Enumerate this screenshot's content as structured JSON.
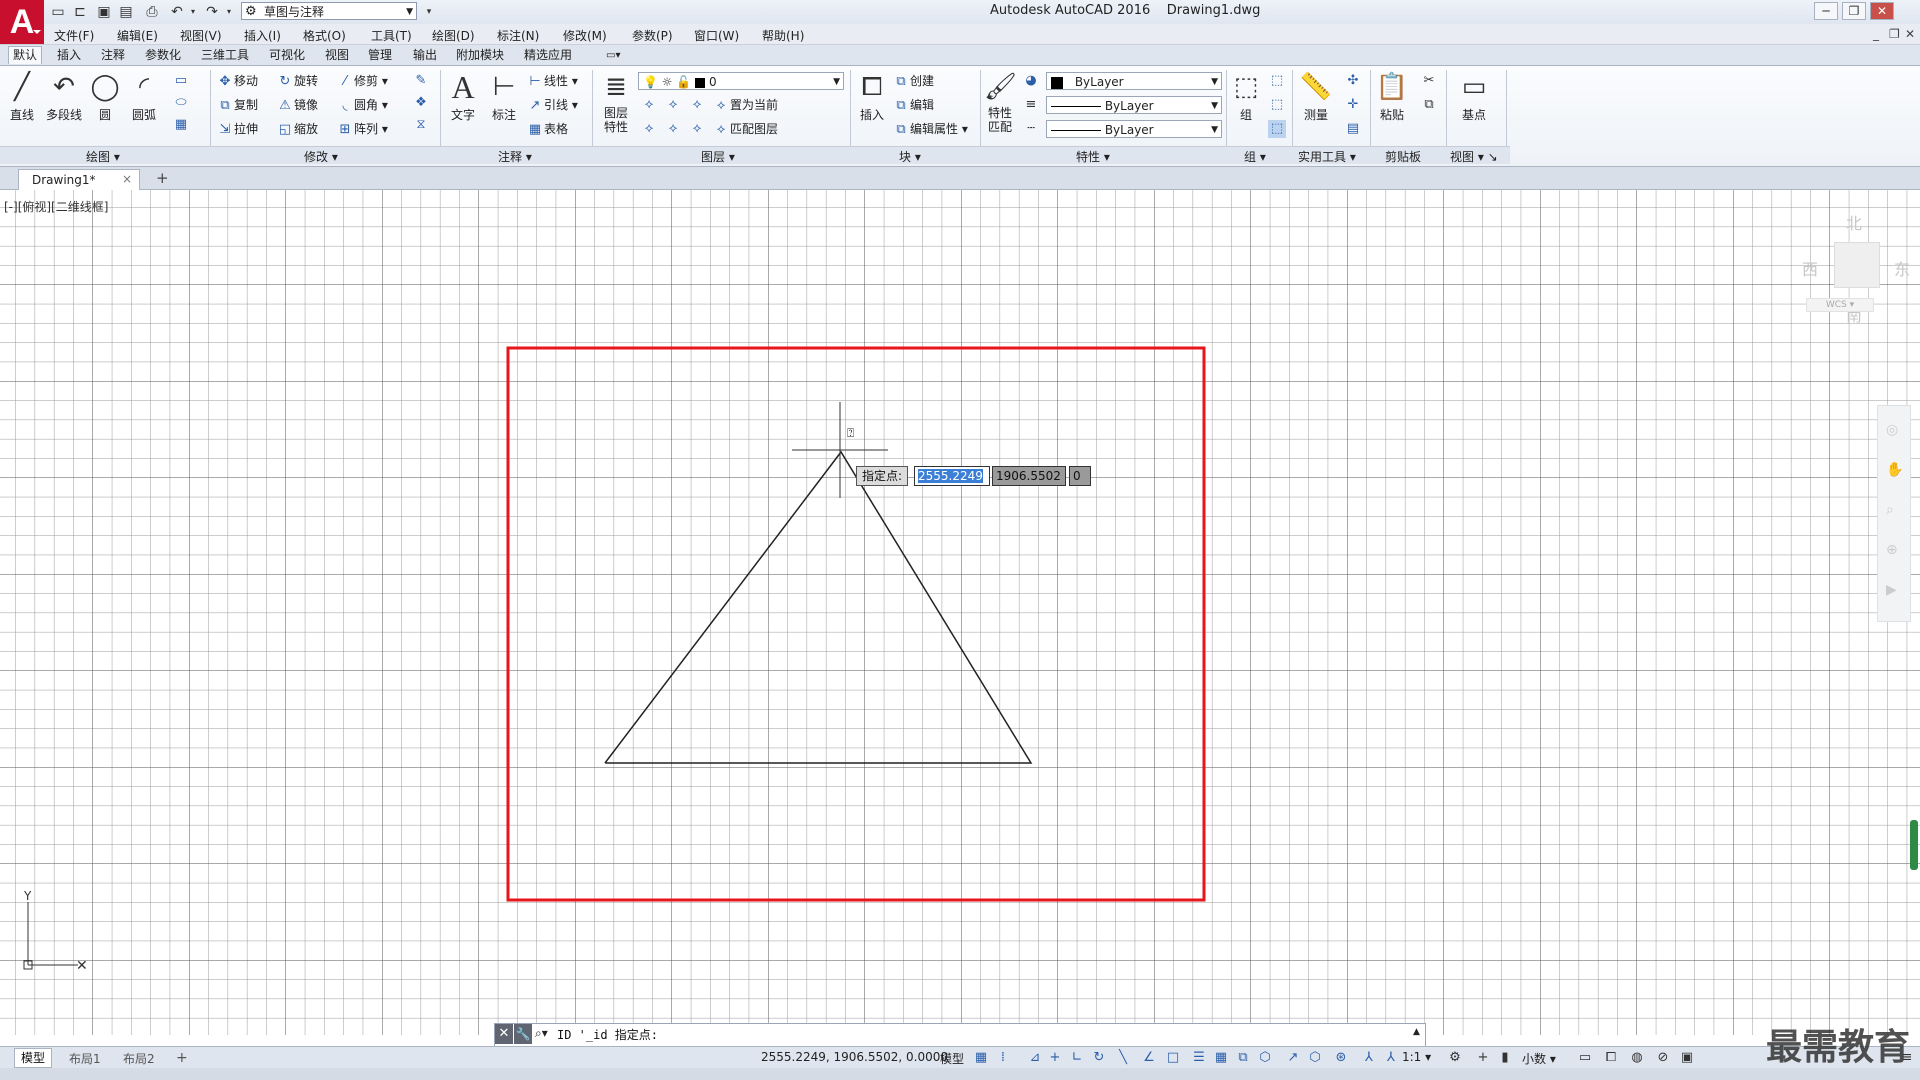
{
  "app": {
    "title_product": "Autodesk AutoCAD 2016",
    "title_file": "Drawing1.dwg",
    "workspace": "草图与注释"
  },
  "menu": [
    "文件(F)",
    "编辑(E)",
    "视图(V)",
    "插入(I)",
    "格式(O)",
    "工具(T)",
    "绘图(D)",
    "标注(N)",
    "修改(M)",
    "参数(P)",
    "窗口(W)",
    "帮助(H)"
  ],
  "ribbon_tabs": [
    "默认",
    "插入",
    "注释",
    "参数化",
    "三维工具",
    "可视化",
    "视图",
    "管理",
    "输出",
    "附加模块",
    "精选应用"
  ],
  "ribbon": {
    "draw": {
      "line": "直线",
      "polyline": "多段线",
      "circle": "圆",
      "arc": "圆弧",
      "title": "绘图"
    },
    "modify": {
      "move": "移动",
      "rotate": "旋转",
      "trim": "修剪",
      "copy": "复制",
      "mirror": "镜像",
      "fillet": "圆角",
      "stretch": "拉伸",
      "scale": "缩放",
      "array": "阵列",
      "title": "修改"
    },
    "annotation": {
      "text": "文字",
      "dimension": "标注",
      "linear": "线性",
      "leader": "引线",
      "table": "表格",
      "title": "注释"
    },
    "layers": {
      "properties_line1": "图层",
      "properties_line2": "特性",
      "current_layer": "0",
      "make_current": "置为当前",
      "match_layer": "匹配图层",
      "title": "图层"
    },
    "block": {
      "insert": "插入",
      "create": "创建",
      "edit": "编辑",
      "edit_attributes": "编辑属性",
      "title": "块"
    },
    "properties": {
      "match_line1": "特性",
      "match_line2": "匹配",
      "color": "ByLayer",
      "linetype": "ByLayer",
      "lineweight": "ByLayer",
      "title": "特性"
    },
    "groups": {
      "group": "组",
      "title": "组"
    },
    "utilities": {
      "measure": "测量",
      "title": "实用工具"
    },
    "clipboard": {
      "paste": "粘贴",
      "title": "剪贴板"
    },
    "view": {
      "base": "基点",
      "title": "视图"
    }
  },
  "file_tab": "Drawing1*",
  "viewport_label": "[-][俯视][二维线框]",
  "viewcube": {
    "north": "北",
    "south": "南",
    "east": "东",
    "west": "西",
    "wcs": "WCS"
  },
  "dynamic_input": {
    "label": "指定点:",
    "x": "2555.2249",
    "y": "1906.5502",
    "z": "0"
  },
  "command_line": "ID '_id 指定点:",
  "layout_tabs": [
    "模型",
    "布局1",
    "布局2"
  ],
  "status": {
    "coords": "2555.2249, 1906.5502, 0.0000",
    "model": "模型",
    "scale": "1:1",
    "units": "小数"
  },
  "watermark": "最需教育",
  "colors": {
    "highlight_rect": "#e8161b",
    "app_red": "#c8102e",
    "grid_line": "#000000"
  }
}
